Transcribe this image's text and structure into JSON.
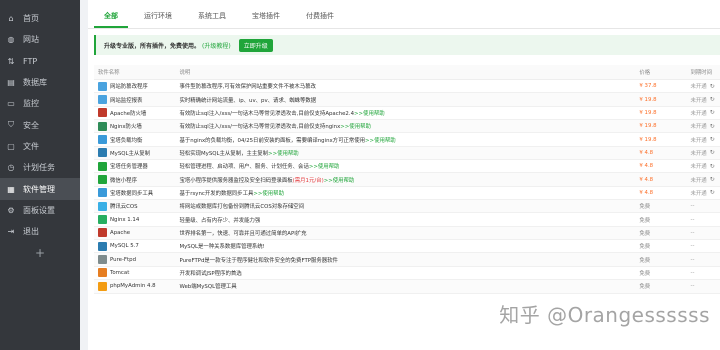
{
  "sidebar": {
    "items": [
      {
        "label": "首页",
        "icon": "home-icon"
      },
      {
        "label": "网站",
        "icon": "globe-icon"
      },
      {
        "label": "FTP",
        "icon": "ftp-icon"
      },
      {
        "label": "数据库",
        "icon": "database-icon"
      },
      {
        "label": "监控",
        "icon": "monitor-icon"
      },
      {
        "label": "安全",
        "icon": "shield-icon"
      },
      {
        "label": "文件",
        "icon": "folder-icon"
      },
      {
        "label": "计划任务",
        "icon": "clock-icon"
      },
      {
        "label": "软件管理",
        "icon": "apps-icon"
      },
      {
        "label": "面板设置",
        "icon": "settings-icon"
      },
      {
        "label": "退出",
        "icon": "logout-icon"
      }
    ],
    "add": "+"
  },
  "tabs": [
    "全部",
    "运行环境",
    "系统工具",
    "宝塔插件",
    "付费插件"
  ],
  "promo": {
    "text1": "升级专业版，所有插件，免费使用。",
    "text2": "(升级教程)",
    "button": "立即升级"
  },
  "table": {
    "headers": [
      "软件名称",
      "说明",
      "价格",
      "到期时间"
    ],
    "rows": [
      {
        "name": "网站防篡改程序",
        "desc": "事件型防篡改程序,可有效保护网站重要文件不被木马篡改",
        "price": "¥ 37.8",
        "expiry": "未开通"
      },
      {
        "name": "网站监控报表",
        "desc": "实时精确统计网站流量、ip、uv、pv、请求、蜘蛛等数据",
        "price": "¥ 19.8",
        "expiry": "未开通"
      },
      {
        "name": "Apache防火墙",
        "desc": "有效防止sql注入/xss/一句话木马等常见渗透攻击,目前仅支持Apache2.4",
        "help": ">>使用帮助",
        "price": "¥ 19.8",
        "expiry": "未开通"
      },
      {
        "name": "Nginx防火墙",
        "desc": "有效防止sql注入/xss/一句话木马等常见渗透攻击,目前仅支持nginx",
        "help": ">>使用帮助",
        "price": "¥ 19.8",
        "expiry": "未开通"
      },
      {
        "name": "宝塔负载均衡",
        "desc": "基于nginx的负载均衡，04/25日前安装的面板，需要编译nginx方可正常使用",
        "help": ">>使用帮助",
        "price": "¥ 19.8",
        "expiry": "未开通"
      },
      {
        "name": "MySQL主从复制",
        "desc": "轻松实现MySQL主从复制，主主复制",
        "help": ">>使用帮助",
        "price": "¥ 4.8",
        "expiry": "未开通"
      },
      {
        "name": "宝塔任务管理器",
        "desc": "轻松管理进程、启动项、用户、服务、计划任务、会话",
        "help": ">>使用帮助",
        "price": "¥ 4.8",
        "expiry": "未开通"
      },
      {
        "name": "微信小程序",
        "desc": "宝塔小程序提供服务器监控及安全扫码登录面板",
        "warn": "(需月1元/台)",
        "help": ">>使用帮助",
        "price": "¥ 4.8",
        "expiry": "未开通"
      },
      {
        "name": "宝塔数据同步工具",
        "desc": "基于rsync开发的数据同步工具",
        "help": ">>使用帮助",
        "price": "¥ 4.8",
        "expiry": "未开通"
      },
      {
        "name": "腾讯云COS",
        "desc": "将网站或数据库打包备份到腾讯云COS对象存储空间",
        "price": "免费",
        "expiry": "--"
      },
      {
        "name": "Nginx 1.14",
        "desc": "轻量级、占有内存少、并发能力强",
        "price": "免费",
        "expiry": "--"
      },
      {
        "name": "Apache",
        "desc": "世界排名第一，快速、可靠并且可通过简单的API扩充",
        "price": "免费",
        "expiry": "--"
      },
      {
        "name": "MySQL 5.7",
        "desc": "MySQL是一种关系数据库管理系统!",
        "price": "免费",
        "expiry": "--"
      },
      {
        "name": "Pure-Ftpd",
        "desc": "PureFTPd是一款专注于程序健壮和软件安全的免费FTP服务器软件",
        "price": "免费",
        "expiry": "--"
      },
      {
        "name": "Tomcat",
        "desc": "开发和调试JSP程序的首选",
        "price": "免费",
        "expiry": "--"
      },
      {
        "name": "phpMyAdmin 4.8",
        "desc": "Web端MySQL管理工具",
        "price": "免费",
        "expiry": "--"
      }
    ]
  },
  "watermark": "知乎 @Orangessssss",
  "colors": {
    "accent": "#20a53a",
    "sidebar_bg": "#34373c",
    "price": "#fc6d26",
    "warn": "#e4393c"
  }
}
